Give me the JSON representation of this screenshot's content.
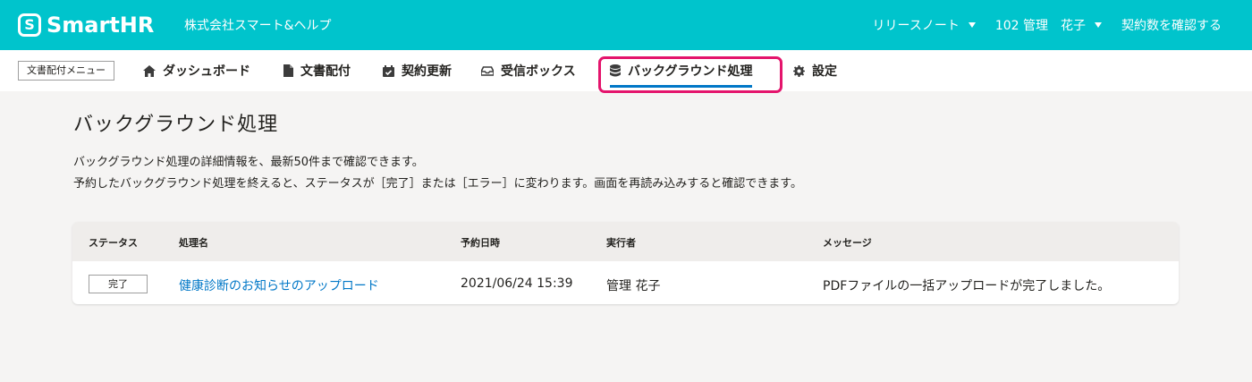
{
  "header": {
    "logo_text": "SmartHR",
    "logo_mark": "S",
    "tenant_name": "株式会社スマート&ヘルプ",
    "release_notes_label": "リリースノート",
    "user_label": "102 管理　花子",
    "contracts_label": "契約数を確認する"
  },
  "nav": {
    "menu_label": "文書配付メニュー",
    "tabs": [
      {
        "label": "ダッシュボード",
        "icon": "dashboard-icon"
      },
      {
        "label": "文書配付",
        "icon": "document-icon"
      },
      {
        "label": "契約更新",
        "icon": "calendar-icon"
      },
      {
        "label": "受信ボックス",
        "icon": "inbox-icon"
      },
      {
        "label": "バックグラウンド処理",
        "icon": "database-icon"
      },
      {
        "label": "設定",
        "icon": "gear-icon"
      }
    ]
  },
  "page": {
    "title": "バックグラウンド処理",
    "description_line1": "バックグラウンド処理の詳細情報を、最新50件まで確認できます。",
    "description_line2": "予約したバックグラウンド処理を終えると、ステータスが［完了］または［エラー］に変わります。画面を再読み込みすると確認できます。"
  },
  "table": {
    "columns": [
      "ステータス",
      "処理名",
      "予約日時",
      "実行者",
      "メッセージ"
    ],
    "rows": [
      {
        "status": "完了",
        "job_name": "健康診断のお知らせのアップロード",
        "scheduled_at": "2021/06/24 15:39",
        "executor": "管理 花子",
        "message": "PDFファイルの一括アップロードが完了しました。"
      }
    ]
  },
  "colors": {
    "header_bg": "#00c4cc",
    "link": "#0077c7",
    "active_underline": "#0077c7",
    "highlight_border": "#e4146c"
  }
}
